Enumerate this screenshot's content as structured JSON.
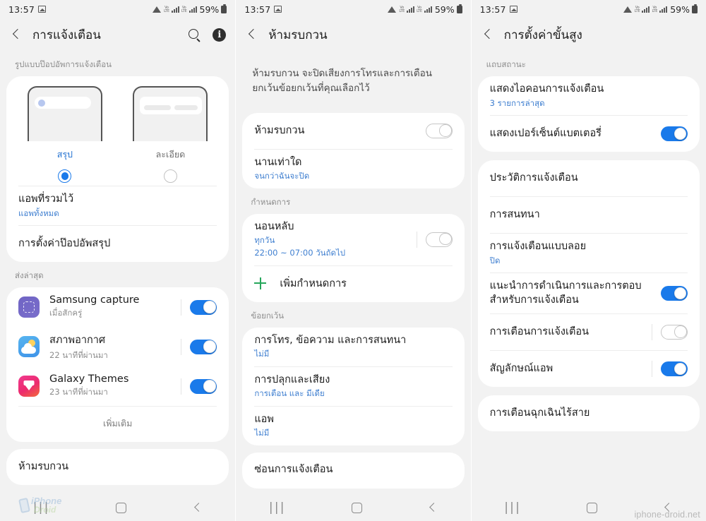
{
  "status_bar": {
    "time": "13:57",
    "battery_percent": "59%",
    "sim1_label": "Vo\nLTE",
    "sim2_label": "Vo\nLTE",
    "icons": [
      "image-icon",
      "wifi-icon",
      "signal-icon",
      "signal-icon",
      "battery-icon"
    ]
  },
  "panel1": {
    "title": "การแจ้งเตือน",
    "actions": [
      "search-icon",
      "info-icon"
    ],
    "style_section_label": "รูปแบบป๊อปอัพการแจ้งเตือน",
    "style_options": [
      {
        "name": "สรุป",
        "selected": true
      },
      {
        "name": "ละเอียด",
        "selected": false
      }
    ],
    "rows": [
      {
        "title": "แอพที่รวมไว้",
        "sub": "แอพทั้งหมด"
      },
      {
        "title": "การตั้งค่าป๊อปอัพสรุป",
        "sub": ""
      }
    ],
    "recent_label": "ส่งล่าสุด",
    "apps": [
      {
        "name": "Samsung capture",
        "time": "เมื่อสักครู่",
        "icon": "samsung-capture-icon",
        "toggle": true
      },
      {
        "name": "สภาพอากาศ",
        "time": "22 นาทีที่ผ่านมา",
        "icon": "weather-icon",
        "toggle": true
      },
      {
        "name": "Galaxy Themes",
        "time": "23 นาทีที่ผ่านมา",
        "icon": "galaxy-themes-icon",
        "toggle": true
      }
    ],
    "more_label": "เพิ่มเติม",
    "bottom_row": "ห้ามรบกวน"
  },
  "panel2": {
    "title": "ห้ามรบกวน",
    "description": "ห้ามรบกวน จะปิดเสียงการโทรและการเตือน ยกเว้นข้อยกเว้นที่คุณเลือกไว้",
    "main_rows": [
      {
        "title": "ห้ามรบกวน",
        "sub": "",
        "toggle": false
      },
      {
        "title": "นานเท่าใด",
        "sub": "จนกว่าฉันจะปิด"
      }
    ],
    "schedule_label": "กำหนดการ",
    "schedule": {
      "title": "นอนหลับ",
      "sub1": "ทุกวัน",
      "sub2": "22:00 ~ 07:00 วันถัดไป",
      "toggle": false
    },
    "add_schedule_label": "เพิ่มกำหนดการ",
    "exception_label": "ข้อยกเว้น",
    "exceptions": [
      {
        "title": "การโทร, ข้อความ และการสนทนา",
        "sub": "ไม่มี"
      },
      {
        "title": "การปลุกและเสียง",
        "sub": "การเตือน และ มีเดีย"
      },
      {
        "title": "แอพ",
        "sub": "ไม่มี"
      }
    ],
    "bottom_row": "ซ่อนการแจ้งเตือน"
  },
  "panel3": {
    "title": "การตั้งค่าขั้นสูง",
    "status_bar_label": "แถบสถานะ",
    "group1": [
      {
        "title": "แสดงไอคอนการแจ้งเตือน",
        "sub": "3 รายการล่าสุด",
        "toggle": null
      },
      {
        "title": "แสดงเปอร์เซ็นต์แบตเตอรี่",
        "sub": "",
        "toggle": true
      }
    ],
    "group2": [
      {
        "title": "ประวัติการแจ้งเตือน",
        "sub": "",
        "toggle": null
      },
      {
        "title": "การสนทนา",
        "sub": "",
        "toggle": null
      },
      {
        "title": "การแจ้งเตือนแบบลอย",
        "sub": "ปิด",
        "toggle": null
      },
      {
        "title": "แนะนำการดำเนินการและการตอบ\nสำหรับการแจ้งเตือน",
        "sub": "",
        "toggle": true
      },
      {
        "title": "การเตือนการแจ้งเตือน",
        "sub": "",
        "toggle": false
      },
      {
        "title": "สัญลักษณ์แอพ",
        "sub": "",
        "toggle": true
      }
    ],
    "group3": [
      {
        "title": "การเตือนฉุกเฉินไร้สาย",
        "sub": "",
        "toggle": null
      }
    ]
  },
  "nav_bar": {
    "recents_label": "|||",
    "home_label": "home-icon",
    "back_label": "back-icon"
  },
  "watermarks": {
    "logo_line1": "iPhone",
    "logo_line2": "Droid",
    "site": "iphone-droid.net"
  },
  "colors": {
    "accent_blue": "#1a7aea",
    "link_blue": "#3f7fd0",
    "bg_grey": "#f2f2f2",
    "card_white": "#ffffff",
    "green": "#26a65b"
  }
}
